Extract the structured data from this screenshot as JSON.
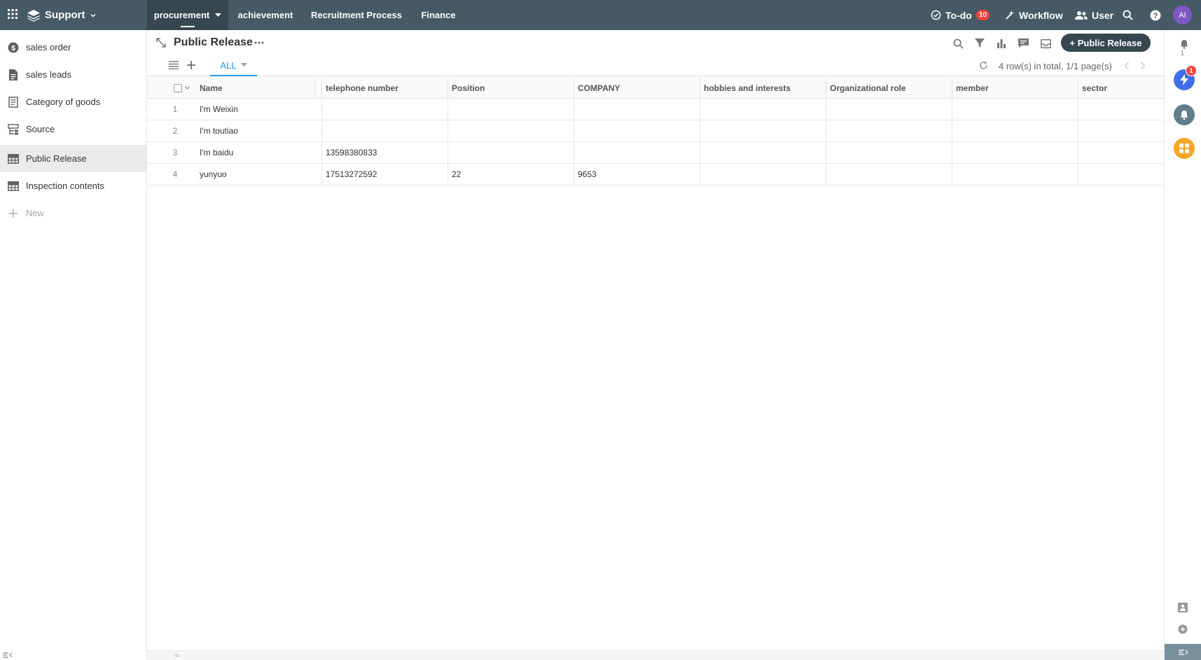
{
  "topbar": {
    "app_name": "Support",
    "tabs": [
      {
        "label": "procurement"
      },
      {
        "label": "achievement"
      },
      {
        "label": "Recruitment Process"
      },
      {
        "label": "Finance"
      }
    ],
    "todo_label": "To-do",
    "todo_count": "10",
    "workflow_label": "Workflow",
    "user_label": "User",
    "avatar_initials": "AI"
  },
  "sidebar": {
    "items": [
      {
        "label": "sales order",
        "icon": "dollar-circle-icon"
      },
      {
        "label": "sales leads",
        "icon": "document-icon"
      },
      {
        "label": "Category of goods",
        "icon": "list-doc-icon"
      },
      {
        "label": "Source",
        "icon": "flowchart-icon"
      },
      {
        "label": "Public Release",
        "icon": "table-icon"
      },
      {
        "label": "Inspection contents",
        "icon": "table-icon"
      }
    ],
    "new_label": "New"
  },
  "main": {
    "title": "Public Release",
    "add_button_label": "+ Public Release",
    "view_tab_label": "ALL",
    "rows_info": "4 row(s) in total, 1/1 page(s)"
  },
  "table": {
    "columns": [
      "Name",
      "telephone number",
      "Position",
      "COMPANY",
      "hobbies and interests",
      "Organizational role",
      "member",
      "sector"
    ],
    "rows": [
      {
        "num": "1",
        "cells": [
          "I'm Weixin",
          "",
          "",
          "",
          "",
          "",
          "",
          ""
        ]
      },
      {
        "num": "2",
        "cells": [
          "I'm toutiao",
          "",
          "",
          "",
          "",
          "",
          "",
          ""
        ]
      },
      {
        "num": "3",
        "cells": [
          "I'm baidu",
          "13598380833",
          "",
          "",
          "",
          "",
          "",
          ""
        ]
      },
      {
        "num": "4",
        "cells": [
          "yunyuo",
          "17513272592",
          "22",
          "9653",
          "",
          "",
          "",
          ""
        ]
      }
    ]
  },
  "rail": {
    "notification_count": "1",
    "lightning_badge": "1"
  },
  "colors": {
    "topbar": "#455a64",
    "accent": "#2196f3",
    "badge": "#f44336",
    "button": "#37474f"
  }
}
